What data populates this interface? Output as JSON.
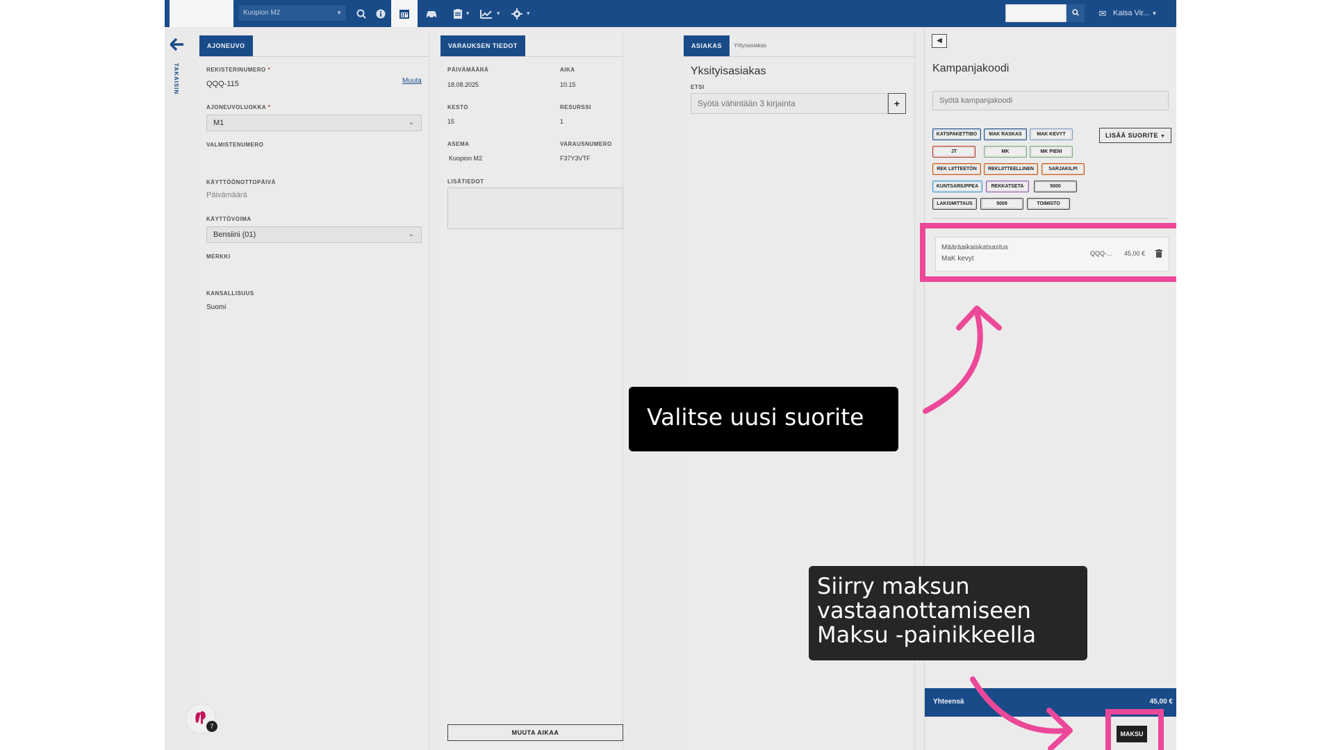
{
  "topbar": {
    "location": "Kuopion M2",
    "user": "Kaisa Vir...",
    "icons": [
      "search-icon",
      "info-icon",
      "calendar-icon",
      "car-icon",
      "clipboard-icon",
      "chart-icon",
      "gear-icon",
      "mail-icon"
    ]
  },
  "sidebar": {
    "back_label": "TAKAISIN"
  },
  "vehicle": {
    "tab": "AJONEUVO",
    "reg_label": "REKISTERINUMERO",
    "reg_value": "QQQ-115",
    "change_link": "Muuta",
    "class_label": "AJONEUVOLUOKKA",
    "class_value": "M1",
    "vin_label": "VALMISTENUMERO",
    "firstuse_label": "KÄYTTÖÖNOTTOPÄIVÄ",
    "firstuse_placeholder": "Päivämäärä",
    "fuel_label": "KÄYTTÖVOIMA",
    "fuel_value": "Bensiini (01)",
    "make_label": "MERKKI",
    "nationality_label": "KANSALLISUUS",
    "nationality_value": "Suomi"
  },
  "booking": {
    "tab": "VARAUKSEN TIEDOT",
    "date_label": "PÄIVÄMÄÄRÄ",
    "date_value": "18.08.2025",
    "time_label": "AIKA",
    "time_value": "10.15",
    "duration_label": "KESTO",
    "duration_value": "15",
    "resource_label": "RESURSSI",
    "resource_value": "1",
    "station_label": "ASEMA",
    "station_value": "Kuopion M2",
    "booking_no_label": "VARAUSNUMERO",
    "booking_no_value": "F37Y3VTF",
    "notes_label": "LISÄTIEDOT",
    "change_time_button": "MUUTA AIKAA"
  },
  "customer": {
    "tab_private": "ASIAKAS",
    "tab_company": "Yritysasiakas",
    "title": "Yksityisasiakas",
    "search_label": "ETSI",
    "search_placeholder": "Syötä vähintään 3 kirjainta",
    "add_button": "+"
  },
  "cart": {
    "campaign_title": "Kampanjakoodi",
    "campaign_placeholder": "Syötä kampanjakoodi",
    "add_service_button": "LISÄÄ SUORITE",
    "chips": [
      {
        "label": "KATSPAKETTIBO",
        "color": "#1b4f8f"
      },
      {
        "label": "MAK RASKAS",
        "color": "#1b4f8f"
      },
      {
        "label": "MAK KEVYT",
        "color": "#7d9fc7"
      },
      {
        "label": "JT",
        "color": "#c0392b"
      },
      {
        "label": "MK",
        "color": "#7fb07f"
      },
      {
        "label": "MK PIENI",
        "color": "#7fb07f"
      },
      {
        "label": "REK LIITTEETÖN",
        "color": "#d35400"
      },
      {
        "label": "REKLIITTEELLINEN",
        "color": "#d35400"
      },
      {
        "label": "SARJAKILPI",
        "color": "#d35400"
      },
      {
        "label": "KUNTSARIUPPEA",
        "color": "#3498db"
      },
      {
        "label": "REKKATSETA",
        "color": "#9b59b6"
      },
      {
        "label": "5000",
        "color": "#444444"
      },
      {
        "label": "LAKISMITTAUS",
        "color": "#444444"
      },
      {
        "label": "5009",
        "color": "#444444"
      },
      {
        "label": "TOIMISTO",
        "color": "#444444"
      }
    ],
    "item": {
      "name": "Määräaikaiskatsastus",
      "sub": "MaK kevyt",
      "reg": "QQQ-...",
      "price": "45,00 €"
    },
    "total_label": "Yhteensä",
    "total_value": "45,00 €",
    "pay_button": "MAKSU"
  },
  "callouts": {
    "first": "Valitse uusi suorite",
    "second_l1": "Siirry maksun",
    "second_l2": "vastaanottamiseen",
    "second_l3": "Maksu -painikkeella"
  },
  "colors": {
    "primary": "#1b4f8f",
    "highlight": "#ec4899"
  },
  "badge_count": "7"
}
